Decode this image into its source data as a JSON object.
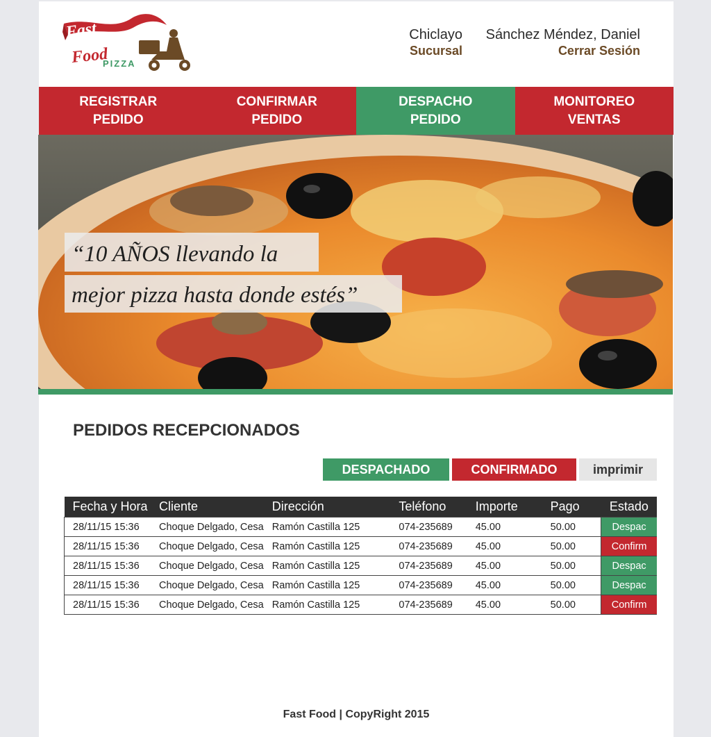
{
  "logo": {
    "line1": "Fast",
    "line2": "Food",
    "line3": "PIZZA"
  },
  "header": {
    "branch": {
      "name": "Chiclayo",
      "label": "Sucursal"
    },
    "user": {
      "name": "Sánchez Méndez, Daniel",
      "logout": "Cerrar Sesión"
    }
  },
  "nav": {
    "items": [
      {
        "line1": "REGISTRAR",
        "line2": "PEDIDO"
      },
      {
        "line1": "CONFIRMAR",
        "line2": "PEDIDO"
      },
      {
        "line1": "DESPACHO",
        "line2": "PEDIDO"
      },
      {
        "line1": "MONITOREO",
        "line2": "VENTAS"
      }
    ],
    "active_index": 2
  },
  "hero": {
    "quote_line1": "“10 AÑOS llevando  la",
    "quote_line2": "mejor pizza hasta donde estés”"
  },
  "section": {
    "title": "PEDIDOS RECEPCIONADOS"
  },
  "actions": {
    "despachado": "DESPACHADO",
    "confirmado": "CONFIRMADO",
    "imprimir": "imprimir"
  },
  "table": {
    "headers": [
      "Fecha y Hora",
      "Cliente",
      "Dirección",
      "Teléfono",
      "Importe",
      "Pago",
      "Estado"
    ],
    "rows": [
      {
        "fecha": "28/11/15  15:36",
        "cliente": "Choque Delgado, Cesa",
        "direccion": "Ramón Castilla 125",
        "telefono": "074-235689",
        "importe": "45.00",
        "pago": "50.00",
        "estado": "Despac"
      },
      {
        "fecha": "28/11/15  15:36",
        "cliente": "Choque Delgado, Cesa",
        "direccion": "Ramón Castilla 125",
        "telefono": "074-235689",
        "importe": "45.00",
        "pago": "50.00",
        "estado": "Confirm"
      },
      {
        "fecha": "28/11/15  15:36",
        "cliente": "Choque Delgado, Cesa",
        "direccion": "Ramón Castilla 125",
        "telefono": "074-235689",
        "importe": "45.00",
        "pago": "50.00",
        "estado": "Despac"
      },
      {
        "fecha": "28/11/15  15:36",
        "cliente": "Choque Delgado, Cesa",
        "direccion": "Ramón Castilla 125",
        "telefono": "074-235689",
        "importe": "45.00",
        "pago": "50.00",
        "estado": "Despac"
      },
      {
        "fecha": "28/11/15  15:36",
        "cliente": "Choque Delgado, Cesa",
        "direccion": "Ramón Castilla 125",
        "telefono": "074-235689",
        "importe": "45.00",
        "pago": "50.00",
        "estado": "Confirm"
      }
    ]
  },
  "footer": {
    "text": "Fast Food | CopyRight 2015"
  },
  "colors": {
    "brand_red": "#c3282f",
    "brand_green": "#3f9a66",
    "brown": "#6b4a26",
    "dark": "#2f2f2f"
  }
}
